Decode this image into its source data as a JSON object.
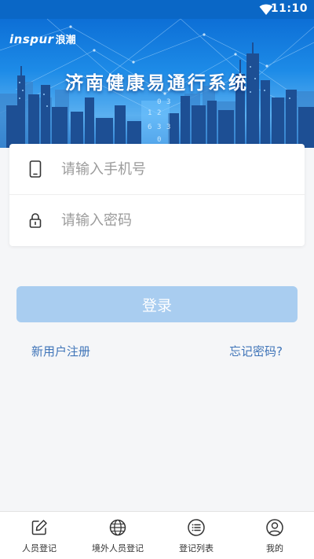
{
  "status_bar": {
    "time": "11:10",
    "icons": [
      "wifi-icon",
      "cellular-icon",
      "battery-icon"
    ]
  },
  "hero": {
    "brand_en": "inspur",
    "brand_cn": "浪潮",
    "title": "济南健康易通行系统",
    "digits": [
      "0",
      "3",
      "1",
      "2",
      "6",
      "3",
      "3",
      "0"
    ]
  },
  "login": {
    "phone_placeholder": "请输入手机号",
    "phone_value": "",
    "password_placeholder": "请输入密码",
    "password_value": "",
    "login_label": "登录",
    "register_link": "新用户注册",
    "forgot_link": "忘记密码?"
  },
  "bottom_nav": {
    "items": [
      {
        "label": "人员登记",
        "icon": "edit-icon"
      },
      {
        "label": "境外人员登记",
        "icon": "globe-icon"
      },
      {
        "label": "登记列表",
        "icon": "list-icon"
      },
      {
        "label": "我的",
        "icon": "user-icon"
      }
    ]
  },
  "colors": {
    "status_bar": "#0a67c6",
    "login_button": "#a9cdf0",
    "link": "#3f74b8",
    "background": "#f5f6f8"
  }
}
